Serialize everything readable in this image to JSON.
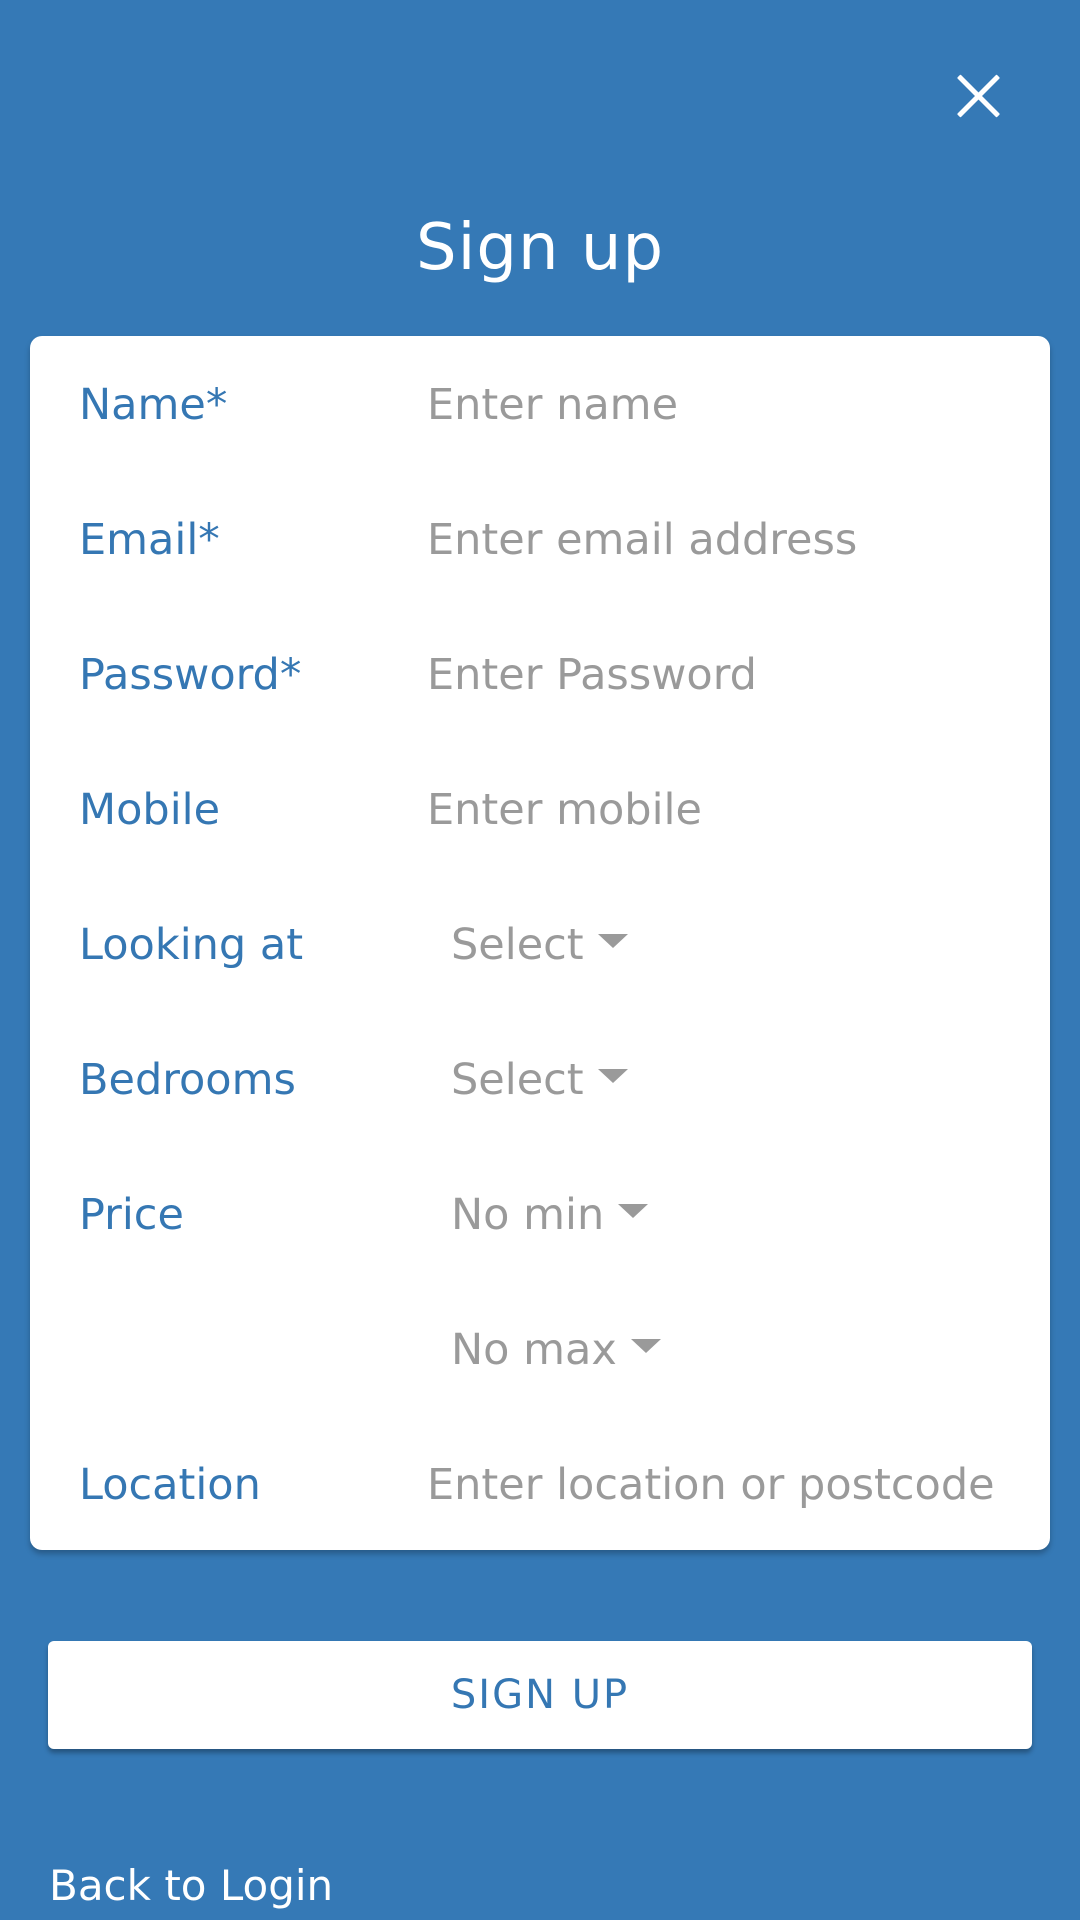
{
  "header": {
    "close_icon": "close-icon",
    "title": "Sign up"
  },
  "form": {
    "name": {
      "label": "Name*",
      "placeholder": "Enter name",
      "value": ""
    },
    "email": {
      "label": "Email*",
      "placeholder": "Enter email address",
      "value": ""
    },
    "password": {
      "label": "Password*",
      "placeholder": "Enter Password",
      "value": ""
    },
    "mobile": {
      "label": "Mobile",
      "placeholder": "Enter mobile",
      "value": ""
    },
    "looking_at": {
      "label": "Looking at",
      "selected": "Select"
    },
    "bedrooms": {
      "label": "Bedrooms",
      "selected": "Select"
    },
    "price": {
      "label": "Price",
      "min_selected": "No min",
      "max_selected": "No max"
    },
    "location": {
      "label": "Location",
      "placeholder": "Enter location or postcode",
      "value": ""
    }
  },
  "actions": {
    "signup_label": "SIGN UP",
    "back_to_login": "Back to Login"
  },
  "colors": {
    "background": "#3579b6",
    "label": "#3577b3",
    "placeholder": "#9a9a9a",
    "card": "#ffffff"
  }
}
